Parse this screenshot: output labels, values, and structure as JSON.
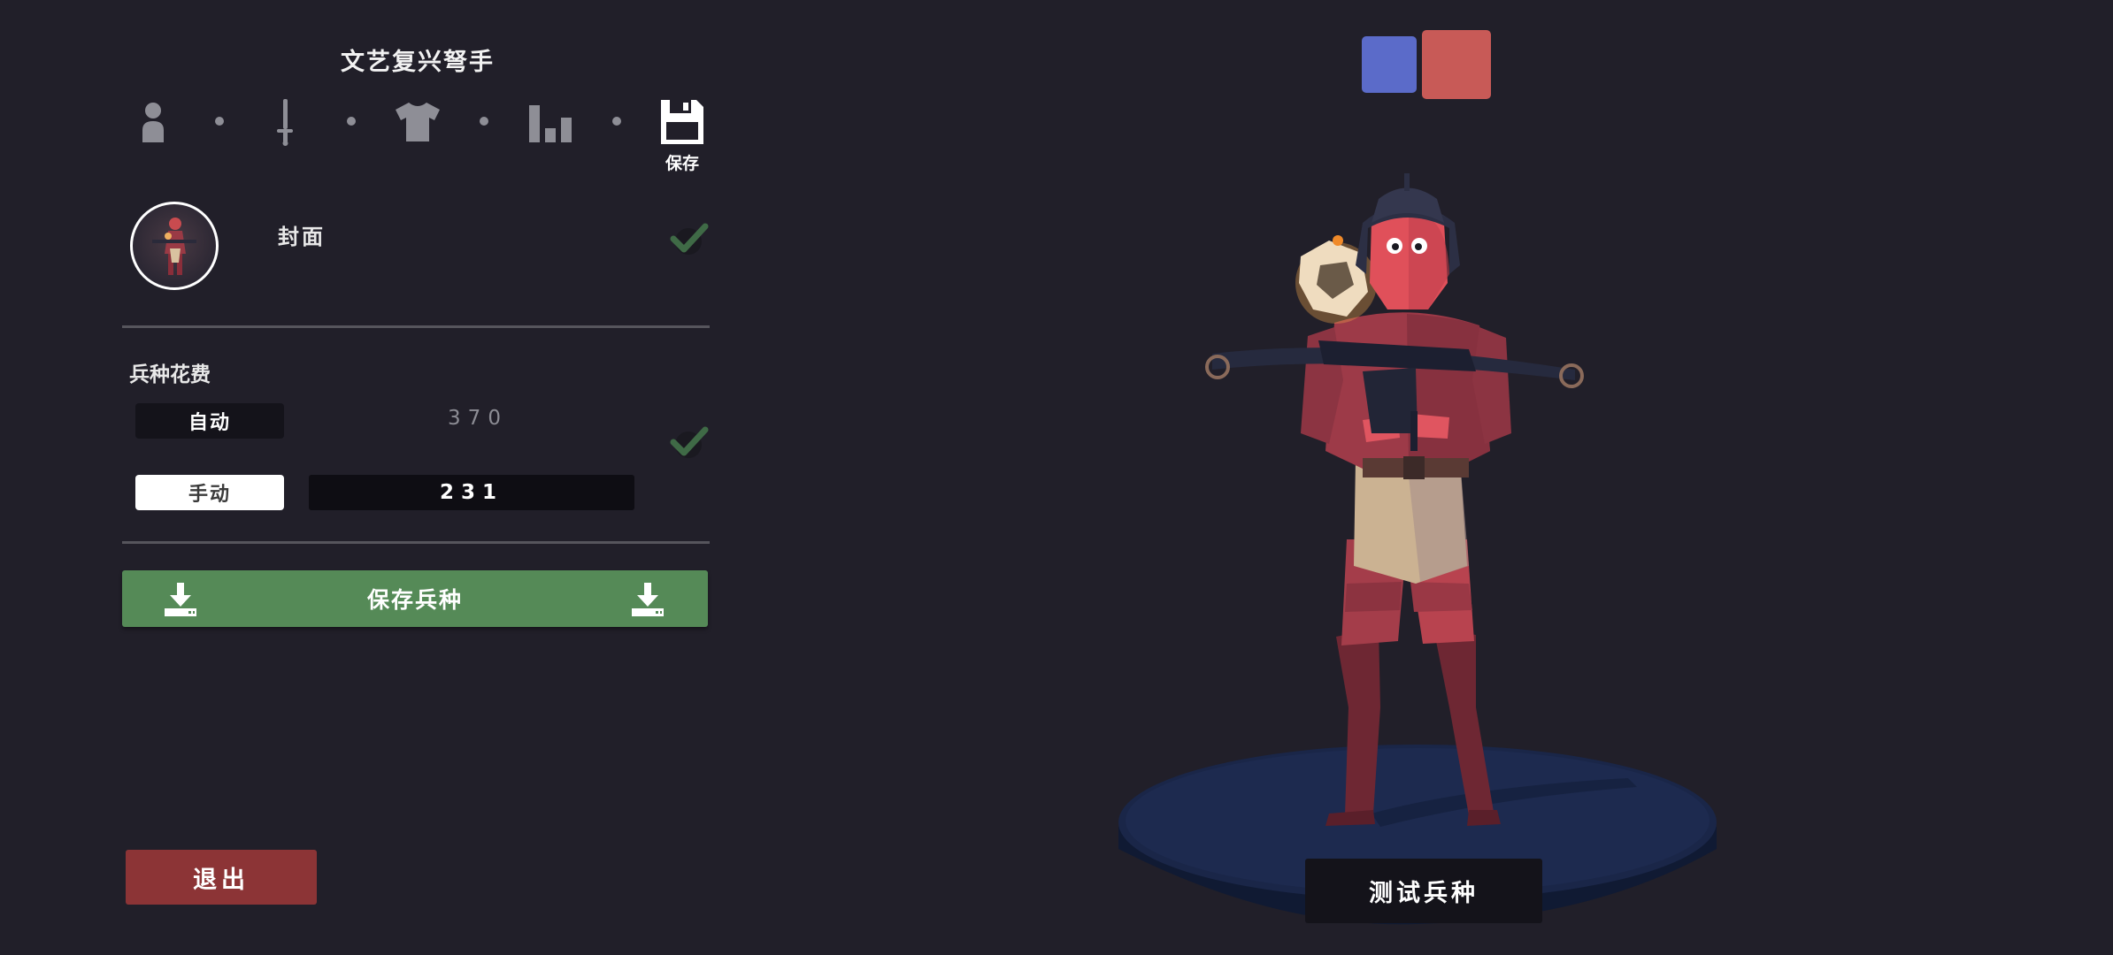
{
  "unit_editor": {
    "title": "文艺复兴弩手",
    "steps": [
      {
        "icon": "person-icon"
      },
      {
        "icon": "sword-icon"
      },
      {
        "icon": "shirt-icon"
      },
      {
        "icon": "stats-icon"
      },
      {
        "icon": "floppy-disk-icon",
        "label": "保存"
      }
    ],
    "cover": {
      "label": "封面",
      "checked": true
    },
    "cost": {
      "label": "兵种花费",
      "auto_label": "自动",
      "auto_value": "370",
      "manual_label": "手动",
      "manual_value": "231",
      "selected": "manual",
      "checked": true
    },
    "save_unit_label": "保存兵种",
    "exit_label": "退出",
    "test_unit_label": "测试兵种"
  },
  "team_colors": {
    "blue": "#5b6bc9",
    "red": "#c85a57",
    "selected": "red"
  },
  "colors": {
    "background": "#211f29",
    "save_green": "#558a57",
    "exit_red": "#8c3436",
    "check_green": "#3f6a46",
    "icon_gray": "#8e8e96"
  }
}
